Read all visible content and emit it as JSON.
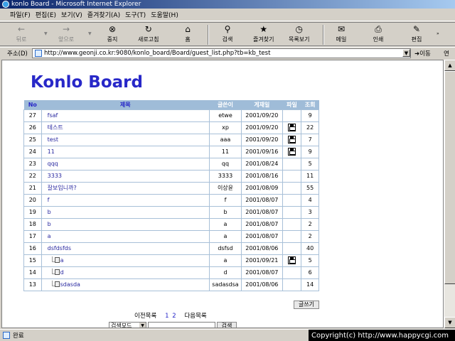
{
  "window": {
    "title": "konlo Board - Microsoft Internet Explorer"
  },
  "menu": [
    "파일(F)",
    "편집(E)",
    "보기(V)",
    "즐겨찾기(A)",
    "도구(T)",
    "도움말(H)"
  ],
  "toolbar": {
    "back": "뒤로",
    "forward": "앞으로",
    "stop": "중지",
    "refresh": "새로고침",
    "home": "홈",
    "search": "검색",
    "favorites": "즐겨찾기",
    "history": "목록보기",
    "mail": "메일",
    "print": "인쇄",
    "edit": "편집"
  },
  "address": {
    "label": "주소(D)",
    "url": "http://www.geonji.co.kr:9080/konlo_board/Board/guest_list.php?tb=kb_test",
    "go": "이동",
    "links": "연"
  },
  "page": {
    "logo": "Konlo Board",
    "columns": {
      "no": "No",
      "title": "제목",
      "author": "글쓴이",
      "date": "게재일",
      "file": "파일",
      "views": "조회"
    },
    "rows": [
      {
        "no": "27",
        "title": "fsaf",
        "author": "etwe",
        "date": "2001/09/20",
        "file": false,
        "views": "9",
        "reply": false
      },
      {
        "no": "26",
        "title": "테스트",
        "author": "xp",
        "date": "2001/09/20",
        "file": true,
        "views": "22",
        "reply": false
      },
      {
        "no": "25",
        "title": "test",
        "author": "aaa",
        "date": "2001/09/20",
        "file": true,
        "views": "7",
        "reply": false
      },
      {
        "no": "24",
        "title": "11",
        "author": "11",
        "date": "2001/09/16",
        "file": true,
        "views": "9",
        "reply": false
      },
      {
        "no": "23",
        "title": "qqq",
        "author": "qq",
        "date": "2001/08/24",
        "file": false,
        "views": "5",
        "reply": false
      },
      {
        "no": "22",
        "title": "3333",
        "author": "3333",
        "date": "2001/08/16",
        "file": false,
        "views": "11",
        "reply": false
      },
      {
        "no": "21",
        "title": "잘보입니까?",
        "author": "이상윤",
        "date": "2001/08/09",
        "file": false,
        "views": "55",
        "reply": false
      },
      {
        "no": "20",
        "title": "f",
        "author": "f",
        "date": "2001/08/07",
        "file": false,
        "views": "4",
        "reply": false
      },
      {
        "no": "19",
        "title": "b",
        "author": "b",
        "date": "2001/08/07",
        "file": false,
        "views": "3",
        "reply": false
      },
      {
        "no": "18",
        "title": "b",
        "author": "a",
        "date": "2001/08/07",
        "file": false,
        "views": "2",
        "reply": false
      },
      {
        "no": "17",
        "title": "a",
        "author": "a",
        "date": "2001/08/07",
        "file": false,
        "views": "2",
        "reply": false
      },
      {
        "no": "16",
        "title": "dsfdsfds",
        "author": "dsfsd",
        "date": "2001/08/06",
        "file": false,
        "views": "40",
        "reply": false
      },
      {
        "no": "15",
        "title": "a",
        "author": "a",
        "date": "2001/09/21",
        "file": true,
        "views": "5",
        "reply": true
      },
      {
        "no": "14",
        "title": "d",
        "author": "d",
        "date": "2001/08/07",
        "file": false,
        "views": "6",
        "reply": true
      },
      {
        "no": "13",
        "title": "sdasda",
        "author": "sadasdsa",
        "date": "2001/08/06",
        "file": false,
        "views": "14",
        "reply": true
      }
    ],
    "write_button": "글쓰기",
    "pager": {
      "prev": "이전목록",
      "pages": [
        "1",
        "2"
      ],
      "next": "다음목록"
    },
    "search": {
      "mode": "검색모드",
      "value": "",
      "button": "검색"
    }
  },
  "status": {
    "text": "완료",
    "copyright": "Copyright(c) http://www.happycgi.com"
  },
  "colors": {
    "header_bg": "#9fbcd8",
    "logo": "#2828c8",
    "link": "#2828a0"
  }
}
